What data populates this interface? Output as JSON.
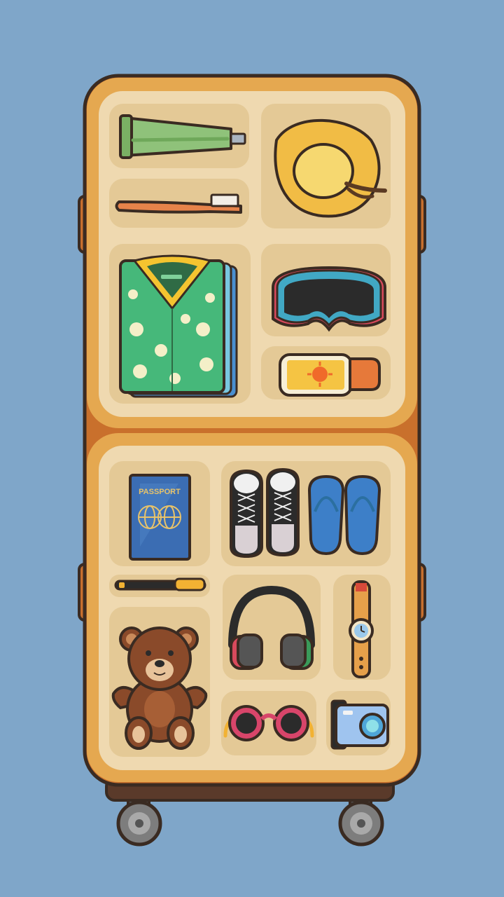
{
  "game": {
    "background_color": "#7fa6c9",
    "suitcase_color": "#e5a850",
    "tray_color": "#efd9b0",
    "slot_color": "#e4c996"
  },
  "upper_compartment": {
    "items": [
      {
        "name": "toothpaste-tube",
        "icon": "toothpaste-icon"
      },
      {
        "name": "toothbrush",
        "icon": "toothbrush-icon"
      },
      {
        "name": "straw-hat",
        "icon": "sun-hat-icon"
      },
      {
        "name": "hawaiian-shirts",
        "icon": "shirt-stack-icon"
      },
      {
        "name": "ski-goggles",
        "icon": "goggles-icon"
      },
      {
        "name": "sunscreen",
        "icon": "sunscreen-bottle-icon"
      }
    ]
  },
  "lower_compartment": {
    "items": [
      {
        "name": "passport",
        "icon": "passport-icon",
        "label": "PASSPORT"
      },
      {
        "name": "sneakers",
        "icon": "sneakers-icon"
      },
      {
        "name": "flip-flops",
        "icon": "flip-flops-icon"
      },
      {
        "name": "pen",
        "icon": "pen-icon"
      },
      {
        "name": "headphones",
        "icon": "headphones-icon"
      },
      {
        "name": "wristwatch",
        "icon": "watch-icon"
      },
      {
        "name": "teddy-bear",
        "icon": "teddy-bear-icon"
      },
      {
        "name": "sunglasses",
        "icon": "sunglasses-icon"
      },
      {
        "name": "camera",
        "icon": "camera-icon"
      }
    ]
  }
}
